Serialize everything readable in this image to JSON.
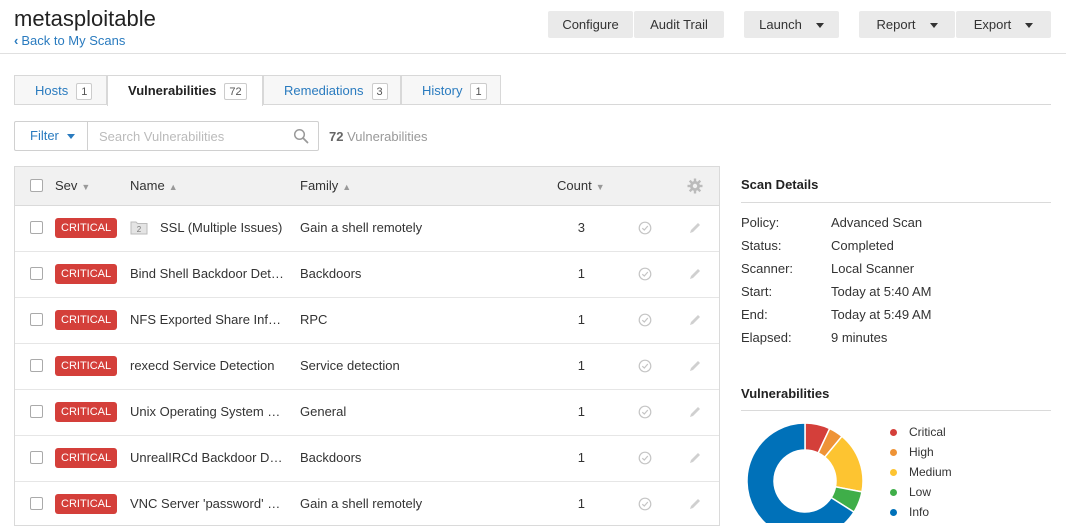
{
  "header": {
    "title": "metasploitable",
    "back_label": "Back to My Scans"
  },
  "toolbar": {
    "configure": "Configure",
    "audit_trail": "Audit Trail",
    "launch": "Launch",
    "report": "Report",
    "export": "Export"
  },
  "tabs": [
    {
      "label": "Hosts",
      "count": "1",
      "active": false
    },
    {
      "label": "Vulnerabilities",
      "count": "72",
      "active": true
    },
    {
      "label": "Remediations",
      "count": "3",
      "active": false
    },
    {
      "label": "History",
      "count": "1",
      "active": false
    }
  ],
  "filter": {
    "label": "Filter",
    "placeholder": "Search Vulnerabilities",
    "count": "72",
    "count_label": " Vulnerabilities"
  },
  "table": {
    "columns": {
      "sev": "Sev",
      "name": "Name",
      "family": "Family",
      "count": "Count"
    },
    "rows": [
      {
        "severity": "CRITICAL",
        "name": "SSL (Multiple Issues)",
        "family": "Gain a shell remotely",
        "count": "3",
        "group_count": "2"
      },
      {
        "severity": "CRITICAL",
        "name": "Bind Shell Backdoor Detection",
        "family": "Backdoors",
        "count": "1"
      },
      {
        "severity": "CRITICAL",
        "name": "NFS Exported Share Information Disclosure",
        "family": "RPC",
        "count": "1"
      },
      {
        "severity": "CRITICAL",
        "name": "rexecd Service Detection",
        "family": "Service detection",
        "count": "1"
      },
      {
        "severity": "CRITICAL",
        "name": "Unix Operating System Unsupported Version Detection",
        "family": "General",
        "count": "1"
      },
      {
        "severity": "CRITICAL",
        "name": "UnrealIRCd Backdoor Detection",
        "family": "Backdoors",
        "count": "1"
      },
      {
        "severity": "CRITICAL",
        "name": "VNC Server 'password' Password",
        "family": "Gain a shell remotely",
        "count": "1"
      }
    ]
  },
  "scan_details": {
    "heading": "Scan Details",
    "items": [
      {
        "label": "Policy:",
        "value": "Advanced Scan"
      },
      {
        "label": "Status:",
        "value": "Completed"
      },
      {
        "label": "Scanner:",
        "value": "Local Scanner"
      },
      {
        "label": "Start:",
        "value": "Today at 5:40 AM"
      },
      {
        "label": "End:",
        "value": "Today at 5:49 AM"
      },
      {
        "label": "Elapsed:",
        "value": "9 minutes"
      }
    ]
  },
  "vuln_chart": {
    "heading": "Vulnerabilities",
    "legend": [
      {
        "label": "Critical",
        "color": "#d43f3a"
      },
      {
        "label": "High",
        "color": "#ee9336"
      },
      {
        "label": "Medium",
        "color": "#fdc431"
      },
      {
        "label": "Low",
        "color": "#3fae49"
      },
      {
        "label": "Info",
        "color": "#0071b9"
      }
    ],
    "share_fractions": [
      0.07,
      0.04,
      0.17,
      0.06,
      0.66
    ]
  },
  "colors": {
    "accent": "#2a7bbf",
    "critical": "#d43f3a"
  }
}
